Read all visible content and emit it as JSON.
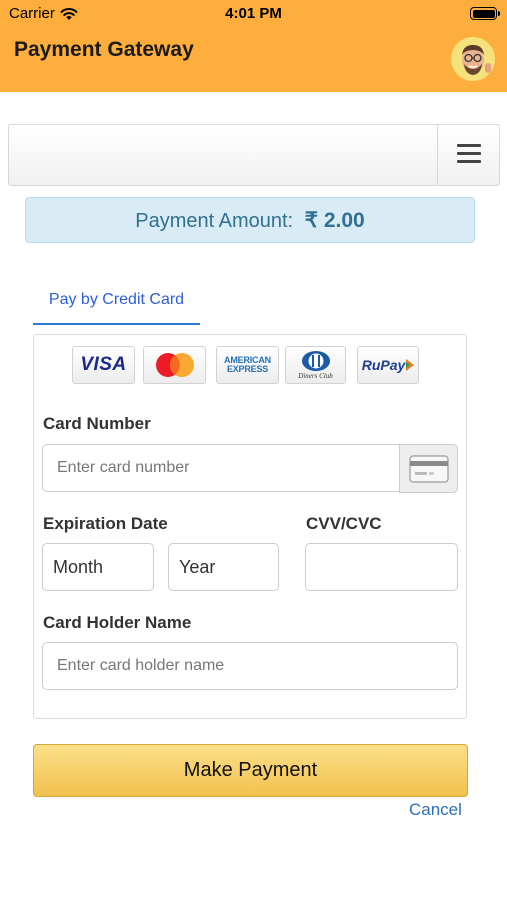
{
  "status_bar": {
    "carrier": "Carrier",
    "time": "4:01 PM"
  },
  "header": {
    "title": "Payment Gateway"
  },
  "amount": {
    "label": "Payment Amount:",
    "value": "₹ 2.00"
  },
  "tabs": [
    {
      "label": "Pay by Credit Card",
      "active": true
    }
  ],
  "card_logos": [
    {
      "icon": "visa-logo",
      "text": "VISA"
    },
    {
      "icon": "mastercard-logo",
      "text": ""
    },
    {
      "icon": "american-express-logo",
      "line1": "AMERICAN",
      "line2": "EXPRESS"
    },
    {
      "icon": "diners-club-logo",
      "text": "Diners Club"
    },
    {
      "icon": "rupay-logo",
      "text": "RuPay"
    }
  ],
  "form": {
    "card_number_label": "Card Number",
    "card_number_placeholder": "Enter card number",
    "expiration_label": "Expiration Date",
    "month_value": "Month",
    "year_value": "Year",
    "cvv_label": "CVV/CVC",
    "holder_label": "Card Holder Name",
    "holder_placeholder": "Enter card holder name"
  },
  "actions": {
    "pay_label": "Make Payment",
    "cancel_label": "Cancel"
  },
  "colors": {
    "header": "#fdae3c",
    "amount_bg": "#d9ecf6",
    "amount_text": "#31708f",
    "tab_active": "#2b5ed9",
    "button": "#f2c14e",
    "link": "#2a6fb8"
  }
}
